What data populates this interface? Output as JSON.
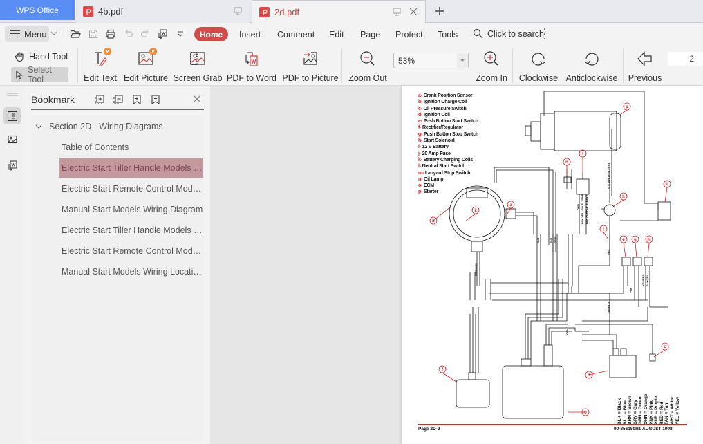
{
  "app": {
    "name": "WPS Office",
    "tabs": [
      {
        "label": "4b.pdf",
        "active": false
      },
      {
        "label": "2d.pdf",
        "active": true
      }
    ],
    "accent_color": "#5b8ef5",
    "doc_tab_color": "#d04040"
  },
  "menubar": {
    "menu_label": "Menu",
    "items": [
      {
        "label": "Home",
        "active": true
      },
      {
        "label": "Insert"
      },
      {
        "label": "Comment"
      },
      {
        "label": "Edit"
      },
      {
        "label": "Page"
      },
      {
        "label": "Protect"
      },
      {
        "label": "Tools"
      }
    ],
    "search_placeholder": "Click to search",
    "home_color": "#d24b4b"
  },
  "ribbon": {
    "hand_tool": "Hand Tool",
    "select_tool": "Select Tool",
    "buttons": [
      {
        "label": "Edit Text",
        "icon": "edit-text-icon"
      },
      {
        "label": "Edit Picture",
        "icon": "edit-picture-icon"
      },
      {
        "label": "Screen Grab",
        "icon": "screen-grab-icon"
      },
      {
        "label": "PDF to Word",
        "icon": "pdf-to-word-icon"
      },
      {
        "label": "PDF to Picture",
        "icon": "pdf-to-picture-icon"
      },
      {
        "label": "Zoom Out",
        "icon": "zoom-out-icon"
      },
      {
        "label": "Zoom In",
        "icon": "zoom-in-icon"
      },
      {
        "label": "Clockwise",
        "icon": "rotate-clockwise-icon"
      },
      {
        "label": "Anticlockwise",
        "icon": "rotate-anticlockwise-icon"
      },
      {
        "label": "Previous",
        "icon": "previous-page-icon"
      }
    ],
    "zoom_value": "53%",
    "page_number": "2"
  },
  "bookmark": {
    "title": "Bookmark",
    "section": "Section 2D - Wiring Diagrams",
    "items": [
      {
        "label": "Table of Contents",
        "selected": false
      },
      {
        "label": "Electric Start Tiller Handle Models Wi...",
        "selected": true
      },
      {
        "label": "Electric Start Remote Control Models...",
        "selected": false
      },
      {
        "label": "Manual Start Models Wiring Diagram",
        "selected": false
      },
      {
        "label": "Electric Start Tiller Handle Models Wi...",
        "selected": false
      },
      {
        "label": "Electric Start Remote Control Models...",
        "selected": false
      },
      {
        "label": "Manual Start Models Wiring Locations",
        "selected": false
      }
    ],
    "selected_color": "#c4999d"
  },
  "document": {
    "legend": [
      {
        "key": "a",
        "text": "Crank Position Sensor"
      },
      {
        "key": "b",
        "text": "Ignition Charge Coil"
      },
      {
        "key": "c",
        "text": "Oil Pressure Switch"
      },
      {
        "key": "d",
        "text": "Ignition Coil"
      },
      {
        "key": "e",
        "text": "Push Button Start Switch"
      },
      {
        "key": "f",
        "text": "Rectifier/Regulator"
      },
      {
        "key": "g",
        "text": "Push Button Stop Switch"
      },
      {
        "key": "h",
        "text": "Start Solenoid"
      },
      {
        "key": "i",
        "text": "12 V Battery"
      },
      {
        "key": "j",
        "text": "20 Amp Fuse"
      },
      {
        "key": "k",
        "text": "Battery Charging Coils"
      },
      {
        "key": "l",
        "text": "Neutral Start Switch"
      },
      {
        "key": "m",
        "text": "Lanyard Stop Switch"
      },
      {
        "key": "n",
        "text": "Oil Lamp"
      },
      {
        "key": "o",
        "text": "ECM"
      },
      {
        "key": "p",
        "text": "Starter"
      }
    ],
    "color_key": [
      "BLK = Black",
      "BLU = Blue",
      "BRN = Brown",
      "GRY = Gray",
      "GRN = Green",
      "ORN = Orange",
      "PNK = Pink",
      "PUR = Purple",
      "RED = Red",
      "TAN = Tan",
      "WHT = White",
      "YEL = Yellow"
    ],
    "callouts": [
      "a",
      "b",
      "c",
      "d",
      "e",
      "f",
      "g",
      "h",
      "i",
      "j",
      "k",
      "l",
      "m",
      "n",
      "o",
      "p"
    ],
    "wire_labels": [
      "BLK",
      "BLU",
      "BRN",
      "GRN",
      "ORN",
      "PNK",
      "RED",
      "YEL/RED",
      "BLK/YEL",
      "TAN/BLU",
      "WHT/GRN",
      "BLK WHITE SLEEVE",
      "BLK YELLOW SLEEVE",
      "BLK PURPLE SLEEVE"
    ],
    "footer_left": "Page 2D-2",
    "footer_right": "90-856159R1  AUGUST 1998"
  }
}
